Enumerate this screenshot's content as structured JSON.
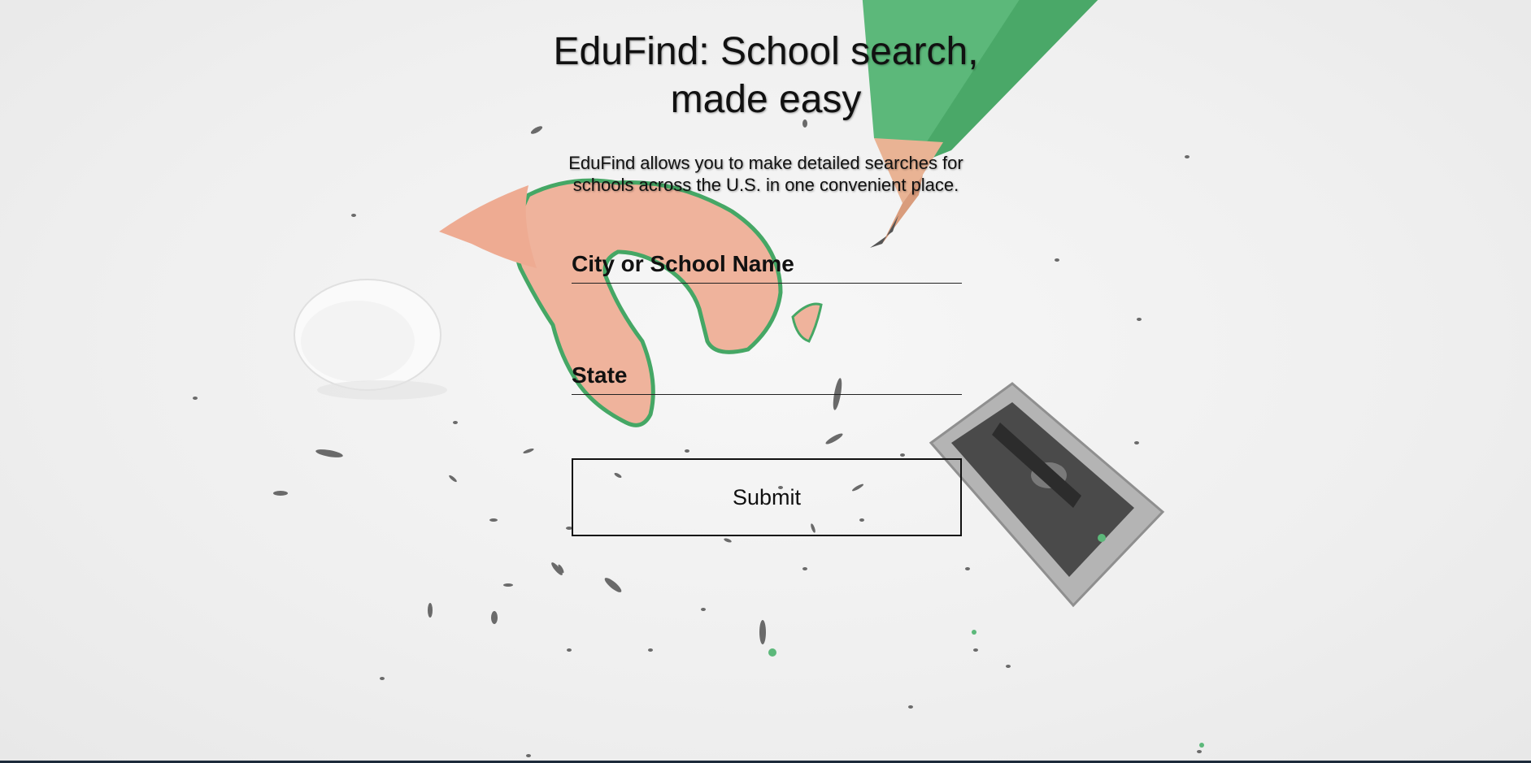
{
  "header": {
    "title_line1": "EduFind: School search,",
    "title_line2": "made easy",
    "description_line1": "EduFind allows you to make detailed searches for",
    "description_line2": "schools across the U.S. in one convenient place."
  },
  "form": {
    "city_placeholder": "City or School Name",
    "city_value": "",
    "state_placeholder": "State",
    "state_value": "",
    "submit_label": "Submit"
  },
  "background": {
    "image_subject": "pencil, shavings, eraser and sharpener on white desk",
    "pencil_color": "#5cb87a",
    "shaving_color": "#e8a58b",
    "accent_dark": "#1c2a3a"
  }
}
